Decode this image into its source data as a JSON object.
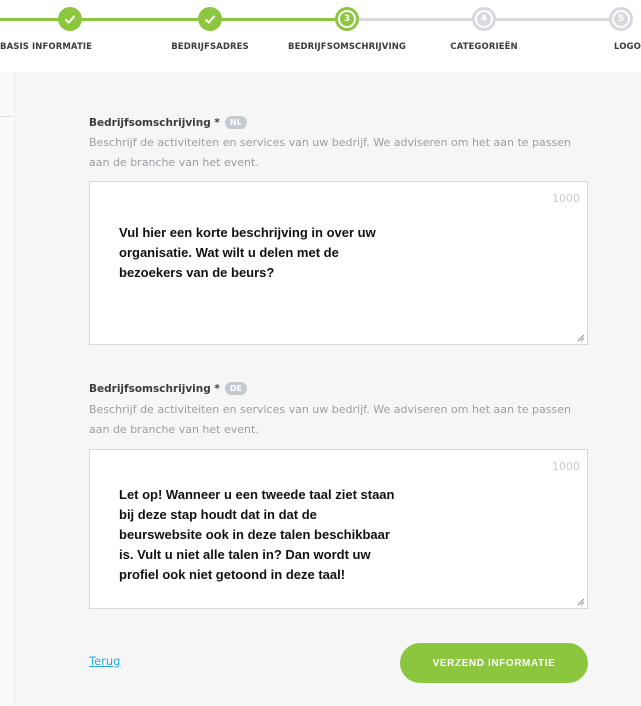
{
  "stepper": {
    "steps": [
      {
        "label": "BASIS INFORMATIE",
        "state": "done",
        "number": ""
      },
      {
        "label": "BEDRIJFSADRES",
        "state": "done",
        "number": ""
      },
      {
        "label": "BEDRIJFSOMSCHRIJVING",
        "state": "current",
        "number": "3"
      },
      {
        "label": "CATEGORIEËN",
        "state": "todo",
        "number": "4"
      },
      {
        "label": "LOGO",
        "state": "todo",
        "number": "5"
      }
    ]
  },
  "form": {
    "fields": [
      {
        "title": "Bedrijfsomschrijving *",
        "lang": "NL",
        "help": "Beschrijf de activiteiten en services van uw bedrijf. We adviseren om het aan te passen aan de branche van het event.",
        "counter": "1000",
        "text_lines": [
          "Vul hier een korte beschrijving in over uw",
          "organisatie. Wat wilt u delen met de",
          "bezoekers van de beurs?"
        ]
      },
      {
        "title": "Bedrijfsomschrijving *",
        "lang": "DE",
        "help": "Beschrijf de activiteiten en services van uw bedrijf. We adviseren om het aan te passen aan de branche van het event.",
        "counter": "1000",
        "text_lines": [
          "Let op! Wanneer u een tweede taal ziet staan",
          "bij deze stap houdt dat in dat de",
          "beurswebsite ook in deze talen beschikbaar",
          "is. Vult u niet alle talen in? Dan wordt uw",
          "profiel ook niet getoond in deze taal!"
        ]
      }
    ],
    "back_label": "Terug",
    "submit_label": "VERZEND INFORMATIE"
  },
  "colors": {
    "accent": "#8cc63f",
    "inactive": "#d6d9dd",
    "link": "#2aa9e0",
    "panel": "#f6f6f7"
  }
}
